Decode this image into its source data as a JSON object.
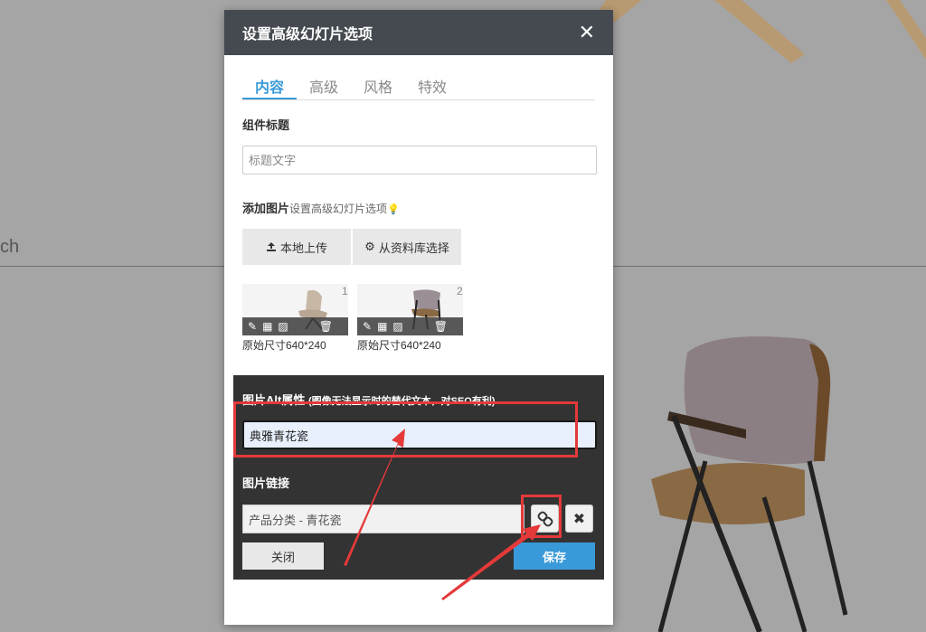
{
  "background": {
    "text_fragment": "ch"
  },
  "dialog": {
    "title": "设置高级幻灯片选项",
    "close_symbol": "✕",
    "tabs": [
      {
        "label": "内容",
        "active": true
      },
      {
        "label": "高级",
        "active": false
      },
      {
        "label": "风格",
        "active": false
      },
      {
        "label": "特效",
        "active": false
      }
    ],
    "component_title": {
      "label": "组件标题",
      "placeholder": "标题文字"
    },
    "add_image": {
      "label": "添加图片",
      "hint": "设置高级幻灯片选项",
      "upload_label": "本地上传",
      "library_label": "从资料库选择"
    },
    "images": [
      {
        "number": "1",
        "caption": "原始尺寸640*240"
      },
      {
        "number": "2",
        "caption": "原始尺寸640*240"
      }
    ],
    "alt_section": {
      "label": "图片Alt属性",
      "hint": "(图像无法显示时的替代文本，对SEO有利)",
      "value": "典雅青花瓷"
    },
    "link_section": {
      "label": "图片链接",
      "value": "产品分类 - 青花瓷"
    },
    "buttons": {
      "close_label": "关闭",
      "save_label": "保存"
    }
  },
  "colors": {
    "header_bg": "#454a51",
    "accent": "#3a9ad9",
    "panel_bg": "#333333",
    "annotation": "#e5393a"
  }
}
